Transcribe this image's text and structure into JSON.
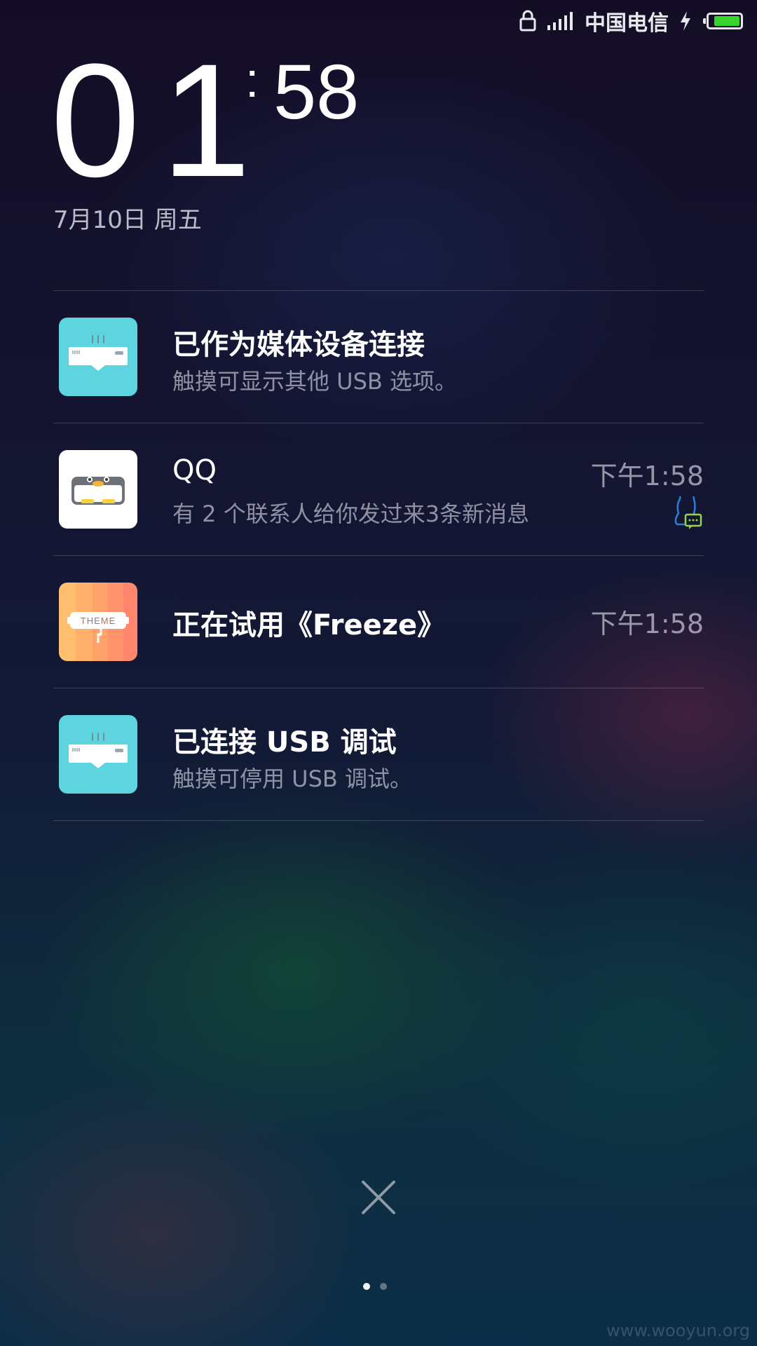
{
  "status_bar": {
    "carrier": "中国电信",
    "icons": [
      "lock-icon",
      "signal-icon",
      "charging-icon",
      "battery-icon"
    ],
    "battery_level": 0.9,
    "battery_color": "#35d52d"
  },
  "clock": {
    "hours": "01",
    "colon": ":",
    "minutes": "58",
    "date": "7月10日 周五"
  },
  "notifications": [
    {
      "app": "USB",
      "icon": "usb-connection-icon",
      "title": "已作为媒体设备连接",
      "subtitle": "触摸可显示其他 USB 选项。",
      "time": ""
    },
    {
      "app": "QQ",
      "icon": "qq-icon",
      "title": "QQ",
      "subtitle": "有 2 个联系人给你发过来3条新消息",
      "time": "下午1:58",
      "badge_icon": "qq-message-badge-icon"
    },
    {
      "app": "Theme",
      "icon": "theme-icon",
      "icon_text": "THEME",
      "title": "正在试用《Freeze》",
      "subtitle": "",
      "time": "下午1:58"
    },
    {
      "app": "USB Debug",
      "icon": "usb-debug-icon",
      "title": "已连接 USB 调试",
      "subtitle": "触摸可停用 USB 调试。",
      "time": ""
    }
  ],
  "controls": {
    "close_icon": "close-icon",
    "page_count": 2,
    "active_page": 1
  },
  "watermark": "www.wooyun.org",
  "colors": {
    "usb_icon_bg": "#5dd4de",
    "theme_icon_bg": "#ff9a6a",
    "qq_badge_blue": "#2a7fd8",
    "qq_badge_green": "#9bd24a"
  }
}
